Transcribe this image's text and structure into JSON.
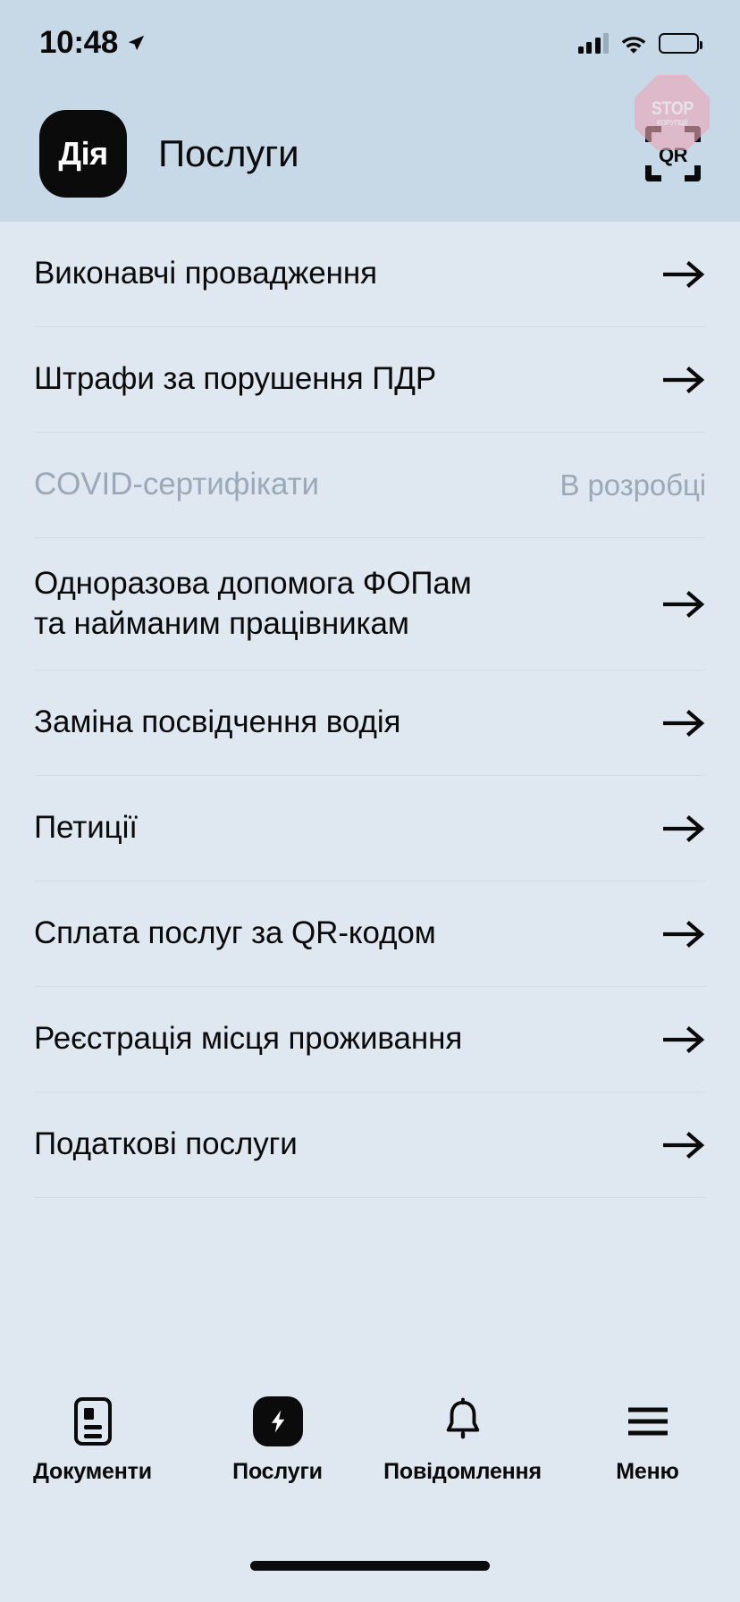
{
  "status_bar": {
    "time": "10:48",
    "location_icon": "location-arrow-icon",
    "signal_icon": "cellular-signal-icon",
    "wifi_icon": "wifi-icon",
    "battery_icon": "battery-icon"
  },
  "watermark": {
    "line1": "STOP",
    "line2": "КОРУПЦІЇ",
    "color": "#eaa6b8"
  },
  "header": {
    "logo_text": "Дія",
    "title": "Послуги",
    "qr_label": "QR"
  },
  "services": [
    {
      "label": "Виконавчі провадження",
      "status": "",
      "disabled": false,
      "two_line": false
    },
    {
      "label": "Штрафи за порушення ПДР",
      "status": "",
      "disabled": false,
      "two_line": false
    },
    {
      "label": "COVID-сертифікати",
      "status": "В розробці",
      "disabled": true,
      "two_line": false
    },
    {
      "label": "Одноразова допомога ФОПам\nта найманим працівникам",
      "status": "",
      "disabled": false,
      "two_line": true
    },
    {
      "label": "Заміна посвідчення водія",
      "status": "",
      "disabled": false,
      "two_line": false
    },
    {
      "label": "Петиції",
      "status": "",
      "disabled": false,
      "two_line": false
    },
    {
      "label": "Сплата послуг за QR-кодом",
      "status": "",
      "disabled": false,
      "two_line": false
    },
    {
      "label": "Реєстрація місця проживання",
      "status": "",
      "disabled": false,
      "two_line": false
    },
    {
      "label": "Податкові послуги",
      "status": "",
      "disabled": false,
      "two_line": false
    }
  ],
  "tabs": [
    {
      "label": "Документи",
      "icon": "document-icon",
      "active": false
    },
    {
      "label": "Послуги",
      "icon": "lightning-bolt-icon",
      "active": true
    },
    {
      "label": "Повідомлення",
      "icon": "bell-icon",
      "active": false
    },
    {
      "label": "Меню",
      "icon": "hamburger-menu-icon",
      "active": false
    }
  ],
  "colors": {
    "header_bg": "#c7d8e6",
    "body_bg": "#dfe7f0",
    "text": "#0a0a0a",
    "muted": "#9aa8b7",
    "divider": "#d2dbe6"
  }
}
